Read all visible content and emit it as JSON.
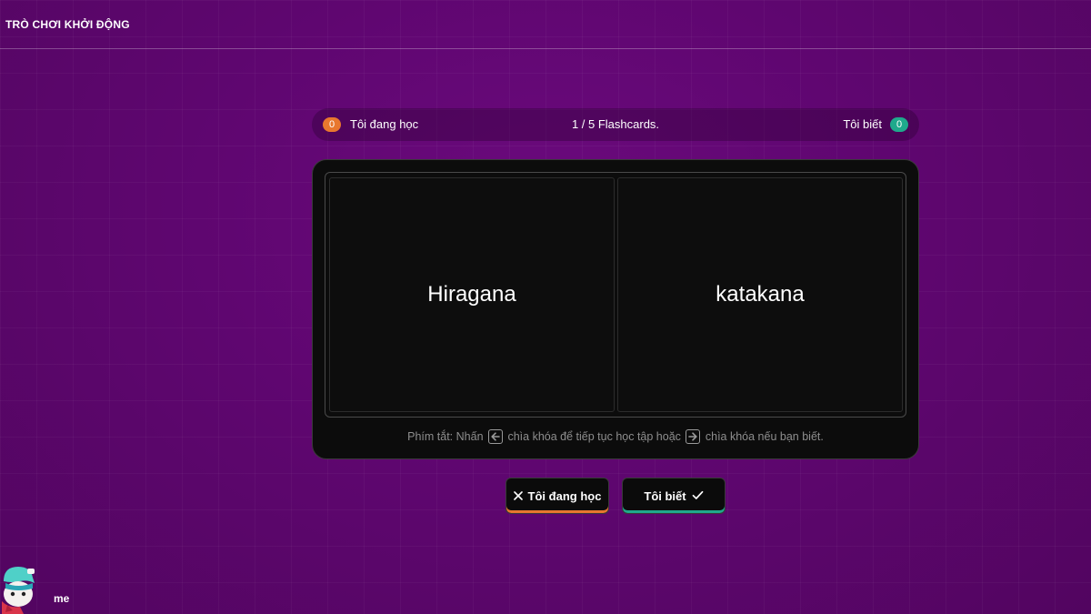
{
  "header": {
    "title": "TRÒ CHƠI KHỞI ĐỘNG"
  },
  "status": {
    "learning_count": "0",
    "learning_label": "Tôi đang học",
    "progress": "1 / 5 Flashcards.",
    "know_label": "Tôi biết",
    "know_count": "0"
  },
  "flashcard": {
    "front": "Hiragana",
    "back": "katakana"
  },
  "hint": {
    "prefix": "Phím tắt: Nhấn",
    "left_text": "chìa khóa để tiếp tục học tập hoặc",
    "right_text": "chìa khóa nếu bạn biết."
  },
  "actions": {
    "learning_button": "Tôi đang học",
    "know_button": "Tôi biết"
  },
  "user": {
    "name": "me"
  },
  "colors": {
    "learning_accent": "#e8772e",
    "know_accent": "#1fa98c"
  },
  "icons": {
    "close": "close-icon",
    "check": "check-icon",
    "arrow_left": "arrow-left-icon",
    "arrow_right": "arrow-right-icon"
  }
}
